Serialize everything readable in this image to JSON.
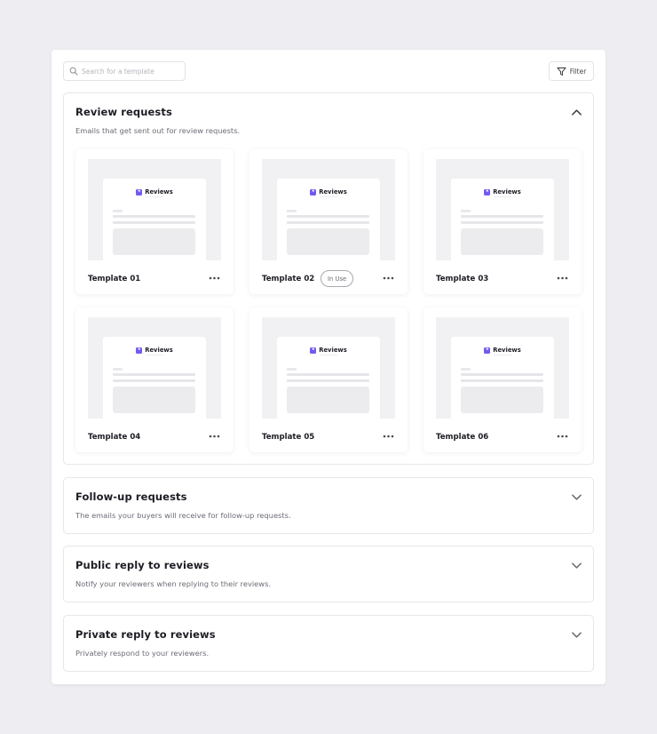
{
  "search": {
    "placeholder": "Search for a template",
    "icon": "search-icon"
  },
  "filter": {
    "label": "Filter",
    "icon": "filter-icon"
  },
  "brand_color": "#7559ee",
  "sections": [
    {
      "title": "Review requests",
      "description": "Emails that get sent out for review requests.",
      "state": "expanded",
      "toggle_icon": "chevron-up-icon",
      "templates": [
        {
          "name": "Template 01",
          "badge": "",
          "brand": "Reviews"
        },
        {
          "name": "Template 02",
          "badge": "In Use",
          "brand": "Reviews"
        },
        {
          "name": "Template 03",
          "badge": "",
          "brand": "Reviews"
        },
        {
          "name": "Template 04",
          "badge": "",
          "brand": "Reviews"
        },
        {
          "name": "Template 05",
          "badge": "",
          "brand": "Reviews"
        },
        {
          "name": "Template 06",
          "badge": "",
          "brand": "Reviews"
        }
      ]
    },
    {
      "title": "Follow-up requests",
      "description": "The emails your buyers will receive for follow-up requests.",
      "state": "collapsed",
      "toggle_icon": "chevron-down-icon"
    },
    {
      "title": "Public reply to reviews",
      "description": "Notify your reviewers when replying to their reviews.",
      "state": "collapsed",
      "toggle_icon": "chevron-down-icon"
    },
    {
      "title": "Private reply to reviews",
      "description": "Privately respond to your reviewers.",
      "state": "collapsed",
      "toggle_icon": "chevron-down-icon"
    }
  ]
}
